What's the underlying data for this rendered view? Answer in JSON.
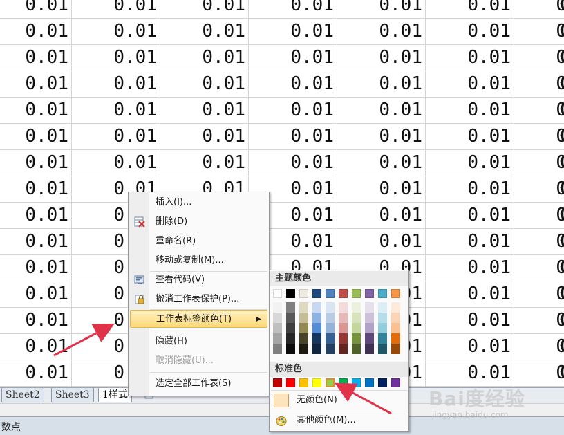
{
  "grid": {
    "cell_value": "0.01",
    "partial_cell_value": "0.01",
    "last_column_partial": "0"
  },
  "tabs": [
    {
      "label": "Sheet2",
      "active": false
    },
    {
      "label": "Sheet3",
      "active": false
    },
    {
      "label": "1样式",
      "active": true
    }
  ],
  "status": {
    "text": "数点"
  },
  "context_menu": {
    "items": [
      {
        "label": "插入(I)...",
        "icon": "",
        "disabled": false
      },
      {
        "label": "删除(D)",
        "icon": "delete-sheet-icon",
        "disabled": false
      },
      {
        "label": "重命名(R)",
        "icon": "",
        "disabled": false
      },
      {
        "label": "移动或复制(M)...",
        "icon": "",
        "disabled": false
      },
      {
        "label": "查看代码(V)",
        "icon": "view-code-icon",
        "disabled": false
      },
      {
        "label": "撤消工作表保护(P)...",
        "icon": "unprotect-sheet-icon",
        "disabled": false
      },
      {
        "label": "工作表标签颜色(T)",
        "icon": "",
        "disabled": false,
        "highlighted": true
      },
      {
        "label": "隐藏(H)",
        "icon": "",
        "disabled": false
      },
      {
        "label": "取消隐藏(U)...",
        "icon": "",
        "disabled": true
      },
      {
        "label": "选定全部工作表(S)",
        "icon": "",
        "disabled": false
      }
    ]
  },
  "palette": {
    "theme_header": "主题颜色",
    "standard_header": "标准色",
    "theme_top": [
      "#ffffff",
      "#000000",
      "#eeece1",
      "#1f497d",
      "#4f81bd",
      "#c0504d",
      "#9bbb59",
      "#8064a2",
      "#4bacc6",
      "#f79646"
    ],
    "theme_shades": [
      [
        "#f2f2f2",
        "#d8d8d8",
        "#bfbfbf",
        "#a5a5a5",
        "#7f7f7f"
      ],
      [
        "#7f7f7f",
        "#595959",
        "#3f3f3f",
        "#262626",
        "#0c0c0c"
      ],
      [
        "#ddd9c3",
        "#c4bd97",
        "#938953",
        "#494429",
        "#1d1b10"
      ],
      [
        "#c6d9f0",
        "#8db3e2",
        "#548dd4",
        "#17365d",
        "#0f243e"
      ],
      [
        "#dbe5f1",
        "#b8cce4",
        "#95b3d7",
        "#366092",
        "#244061"
      ],
      [
        "#f2dcdb",
        "#e5b9b7",
        "#d99694",
        "#953734",
        "#632423"
      ],
      [
        "#ebf1dd",
        "#d7e3bc",
        "#c3d69b",
        "#76923c",
        "#4f6128"
      ],
      [
        "#e5e0ec",
        "#ccc1d9",
        "#b2a2c7",
        "#5f497a",
        "#3f3151"
      ],
      [
        "#dbeef3",
        "#b7dde8",
        "#92cddc",
        "#31859b",
        "#205867"
      ],
      [
        "#fdeada",
        "#fbd5b5",
        "#fac08f",
        "#e36c09",
        "#974806"
      ]
    ],
    "standard": [
      "#c00000",
      "#ff0000",
      "#ffc000",
      "#ffff00",
      "#92d050",
      "#00b050",
      "#00b0f0",
      "#0070c0",
      "#002060",
      "#7030a0"
    ],
    "selected_standard_index": 4,
    "no_color_label": "无颜色(N)",
    "more_colors_label": "其他颜色(M)..."
  },
  "watermark": {
    "text": "Bai度经验",
    "sub": "jingyan.baidu.com"
  },
  "accent": {
    "arrow": "#e0334a"
  }
}
